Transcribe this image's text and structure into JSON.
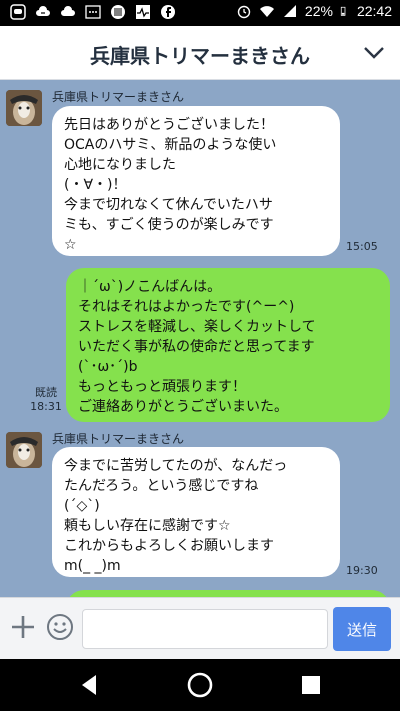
{
  "statusbar": {
    "battery": "22%",
    "time": "22:42",
    "left_icons": [
      "line-icon",
      "cloud-sync-icon",
      "cloud-icon",
      "dots-icon",
      "barcode-icon",
      "pulse-icon",
      "facebook-icon"
    ],
    "right_icons": [
      "alarm-icon",
      "wifi-icon",
      "signal-icon",
      "battery-icon"
    ]
  },
  "header": {
    "title": "兵庫県トリマーまきさん",
    "menu_icon": "chevron-down-icon"
  },
  "messages": [
    {
      "direction": "in",
      "sender": "兵庫県トリマーまきさん",
      "text": "先日はありがとうございました！\nOCAのハサミ、新品のような使い\n心地になりました\n(・∀・)！\n今まで切れなくて休んでいたハサ\nミも、すごく使うのが楽しみです\n☆",
      "time": "15:05"
    },
    {
      "direction": "out",
      "text": "｜´ω`)ノこんばんは。\nそれはそれはよかったです(^ー^)\nストレスを軽減し、楽しくカットして\nいただく事が私の使命だと思ってます\n(`･ω･´)b\nもっともっと頑張ります！\nご連絡ありがとうございまいた。",
      "read": "既読",
      "time": "18:31"
    },
    {
      "direction": "in",
      "sender": "兵庫県トリマーまきさん",
      "text": "今までに苦労してたのが、なんだっ\nたんだろう。という感じですね\n(´◇`)\n頼もしい存在に感謝です☆\nこれからもよろしくお願いします\nm(_ _)m",
      "time": "19:30"
    }
  ],
  "input": {
    "placeholder": "",
    "send_label": "送信",
    "plus_icon": "plus-icon",
    "emoji_icon": "emoji-icon"
  },
  "navbar": {
    "icons": [
      "back-icon",
      "home-icon",
      "recents-icon"
    ]
  },
  "colors": {
    "chat_bg": "#8ca6c6",
    "outgoing_bubble": "#85e14d",
    "incoming_bubble": "#ffffff",
    "send_button": "#4f86e8"
  }
}
